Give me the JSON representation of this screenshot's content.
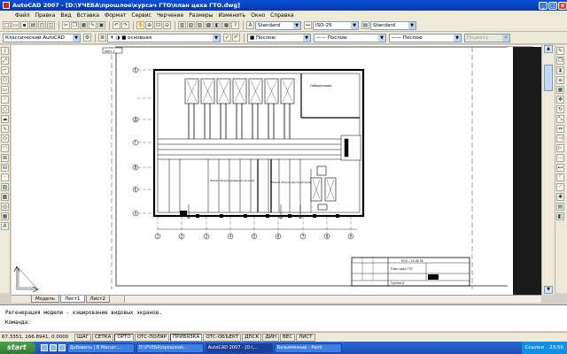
{
  "window": {
    "title": "AutoCAD 2007 - [D:\\УЧЕБА\\прошлое\\курсач ГТО\\план цеха ГТО.dwg]",
    "min_label": "_",
    "max_label": "□",
    "close_label": "x"
  },
  "menu": [
    "Файл",
    "Правка",
    "Вид",
    "Вставка",
    "Формат",
    "Сервис",
    "Черчение",
    "Размеры",
    "Изменить",
    "Окно",
    "Справка"
  ],
  "toolbar": {
    "text_style": "Standard",
    "dim_style": "ISO-25",
    "table_style": "Standard"
  },
  "toolbar2": {
    "workspace": "Классический AutoCAD",
    "layer": "основная",
    "color": "Послою",
    "linetype": "Послою",
    "lineweight": "Послою",
    "plotstyle": "Поцвету"
  },
  "drawing": {
    "stamp": "лист 1",
    "room_label": "Лаборатория",
    "line_label_1": "Линия сборки водяных насосов",
    "line_label_2": "Линия сборки вентиляторов",
    "axes_rows": [
      "Е",
      "Д",
      "Г",
      "В",
      "Б",
      "А"
    ],
    "axes_cols": [
      "1",
      "2",
      "3",
      "4",
      "5",
      "6",
      "7",
      "8",
      "9"
    ],
    "titleblock_code": "ПСХ – 15.08.36",
    "titleblock_name": "План цеха ГТО",
    "titleblock_sub": "Группа А"
  },
  "tabs": [
    "Модель",
    "Лист1",
    "Лист2"
  ],
  "command_line": {
    "history": "Регенерация модели - кэширование видовых экранов.",
    "prompt": "Команда:"
  },
  "status": {
    "coords": "67.3351, 166.8941, 0.0000",
    "buttons": [
      "ШАГ",
      "СЕТКА",
      "ОРТО",
      "ОТС-ПОЛЯР",
      "ПРИВЯЗКА",
      "ОТС-ОБЪЕКТ",
      "ДПСК",
      "ДИН",
      "ВЕС",
      "ЛИСТ"
    ]
  },
  "taskbar": {
    "start": "start",
    "tasks": [
      "Добавить | В Масшт...",
      "D:\\УЧЕБА\\прошлое\\...",
      "AutoCAD 2007 - [D:\\...",
      "Безымянный - Paint"
    ],
    "tray_label": "Ссылки",
    "clock": "23:56"
  }
}
